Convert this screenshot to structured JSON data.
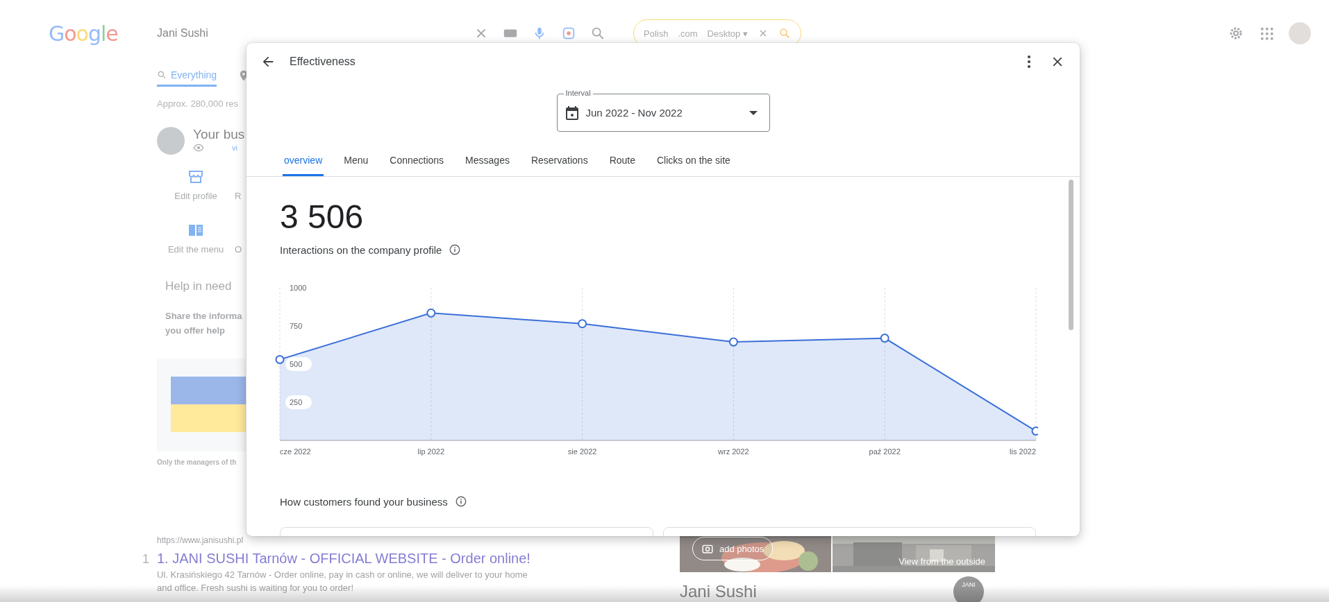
{
  "search_page": {
    "logo": "Google",
    "query": "Jani Sushi",
    "search_tools": {
      "language": "Polish",
      "domain": ".com",
      "device": "Desktop ▾"
    },
    "tabs": [
      {
        "label": "Everything",
        "selected": true
      }
    ],
    "results_count": "Approx. 280,000 res",
    "business": {
      "title": "Your bus",
      "link": "vi"
    },
    "actions": [
      {
        "label": "Edit profile",
        "kind": "store"
      },
      {
        "label": "R",
        "kind": "none"
      },
      {
        "label": "Edit the menu",
        "kind": "menu"
      },
      {
        "label": "O",
        "kind": "none"
      }
    ],
    "help": {
      "title": "Help in need",
      "lines": [
        "Share the informa",
        "you offer help"
      ],
      "note": "Only the managers of th"
    },
    "result": {
      "number": "1",
      "url": "https://www.janisushi.pl",
      "title": "1. JANI SUSHI Tarnów - OFFICIAL WEBSITE - Order online!",
      "snippet_lines": [
        "Ul. Krasińskiego 42 Tarnów - Order online, pay in cash or online, we will deliver to your home",
        "and office. Fresh sushi is waiting for you to order!"
      ]
    },
    "photos": {
      "add_button": "add photos",
      "caption": "View from the outside"
    },
    "place": {
      "name": "Jani Sushi",
      "logo": "JANI"
    }
  },
  "dialog": {
    "title": "Effectiveness",
    "interval": {
      "label": "Interval",
      "value": "Jun 2022 - Nov 2022"
    },
    "tabs": [
      {
        "label": "overview",
        "selected": true
      },
      {
        "label": "Menu",
        "selected": false
      },
      {
        "label": "Connections",
        "selected": false
      },
      {
        "label": "Messages",
        "selected": false
      },
      {
        "label": "Reservations",
        "selected": false
      },
      {
        "label": "Route",
        "selected": false
      },
      {
        "label": "Clicks on the site",
        "selected": false
      }
    ],
    "total": "3 506",
    "total_label": "Interactions on the company profile",
    "chart_data": {
      "type": "area",
      "categories": [
        "cze 2022",
        "lip 2022",
        "sie 2022",
        "wrz 2022",
        "paź 2022",
        "lis 2022"
      ],
      "series": [
        {
          "color": "#3b6fd8",
          "values": [
            530,
            835,
            765,
            645,
            670,
            61
          ]
        }
      ],
      "ylim": [
        0,
        1000
      ],
      "yticks": [
        250,
        500,
        750,
        1000
      ],
      "grid": true
    },
    "section_title": "How customers found your business"
  }
}
